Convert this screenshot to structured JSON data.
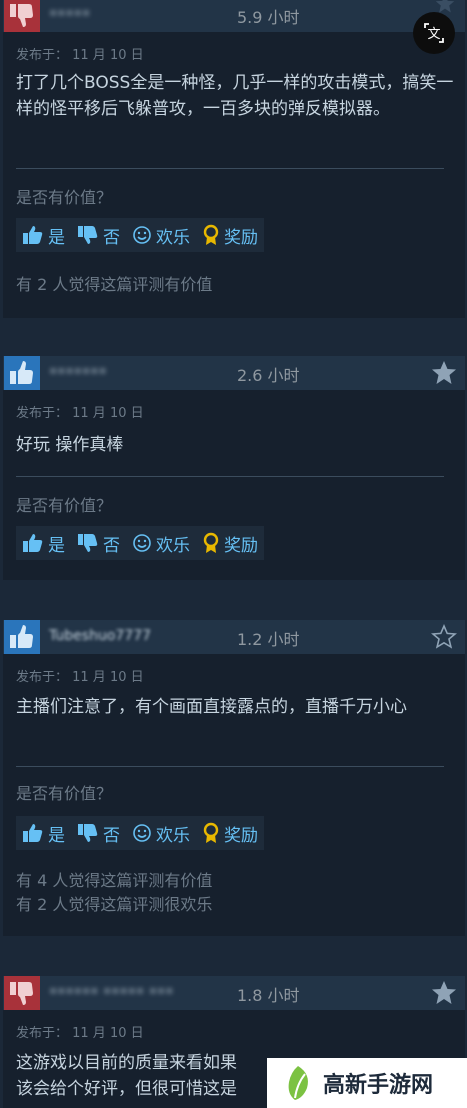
{
  "reviews": [
    {
      "recommended": false,
      "username": "•••••",
      "hours": "5.9 小时",
      "posted": "发布于： 11 月 10 日",
      "content": "打了几个BOSS全是一种怪，几乎一样的攻击模式，搞笑一样的怪平移后飞躲普攻，一百多块的弹反模拟器。",
      "helpful_question": "是否有价值？",
      "buttons": {
        "yes": "是",
        "no": "否",
        "funny": "欢乐",
        "award": "奖励"
      },
      "helpful_counts": [
        "有 2 人觉得这篇评测有价值"
      ]
    },
    {
      "recommended": true,
      "username": "•••••••",
      "hours": "2.6 小时",
      "posted": "发布于： 11 月 10 日",
      "content": "好玩 操作真棒",
      "helpful_question": "是否有价值？",
      "buttons": {
        "yes": "是",
        "no": "否",
        "funny": "欢乐",
        "award": "奖励"
      },
      "helpful_counts": []
    },
    {
      "recommended": true,
      "username": "Tubeshuo7777",
      "hours": "1.2 小时",
      "posted": "发布于： 11 月 10 日",
      "content": "主播们注意了，有个画面直接露点的，直播千万小心",
      "helpful_question": "是否有价值？",
      "buttons": {
        "yes": "是",
        "no": "否",
        "funny": "欢乐",
        "award": "奖励"
      },
      "helpful_counts": [
        "有 4 人觉得这篇评测有价值",
        "有 2 人觉得这篇评测很欢乐"
      ]
    },
    {
      "recommended": false,
      "username": "•••••• ••••• •••",
      "hours": "1.8 小时",
      "posted": "发布于： 11 月 10 日",
      "content_lines": [
        "这游戏以目前的质量来看如果",
        "该会给个好评，但很可惜这是"
      ]
    }
  ],
  "overlay": {
    "translate_icon": "文"
  },
  "watermark": {
    "text": "高新手游网"
  },
  "colors": {
    "background": "#1b2838",
    "header": "#223447",
    "thumb_up": "#2a75bb",
    "thumb_down": "#a8323a",
    "link": "#66c0f4"
  }
}
